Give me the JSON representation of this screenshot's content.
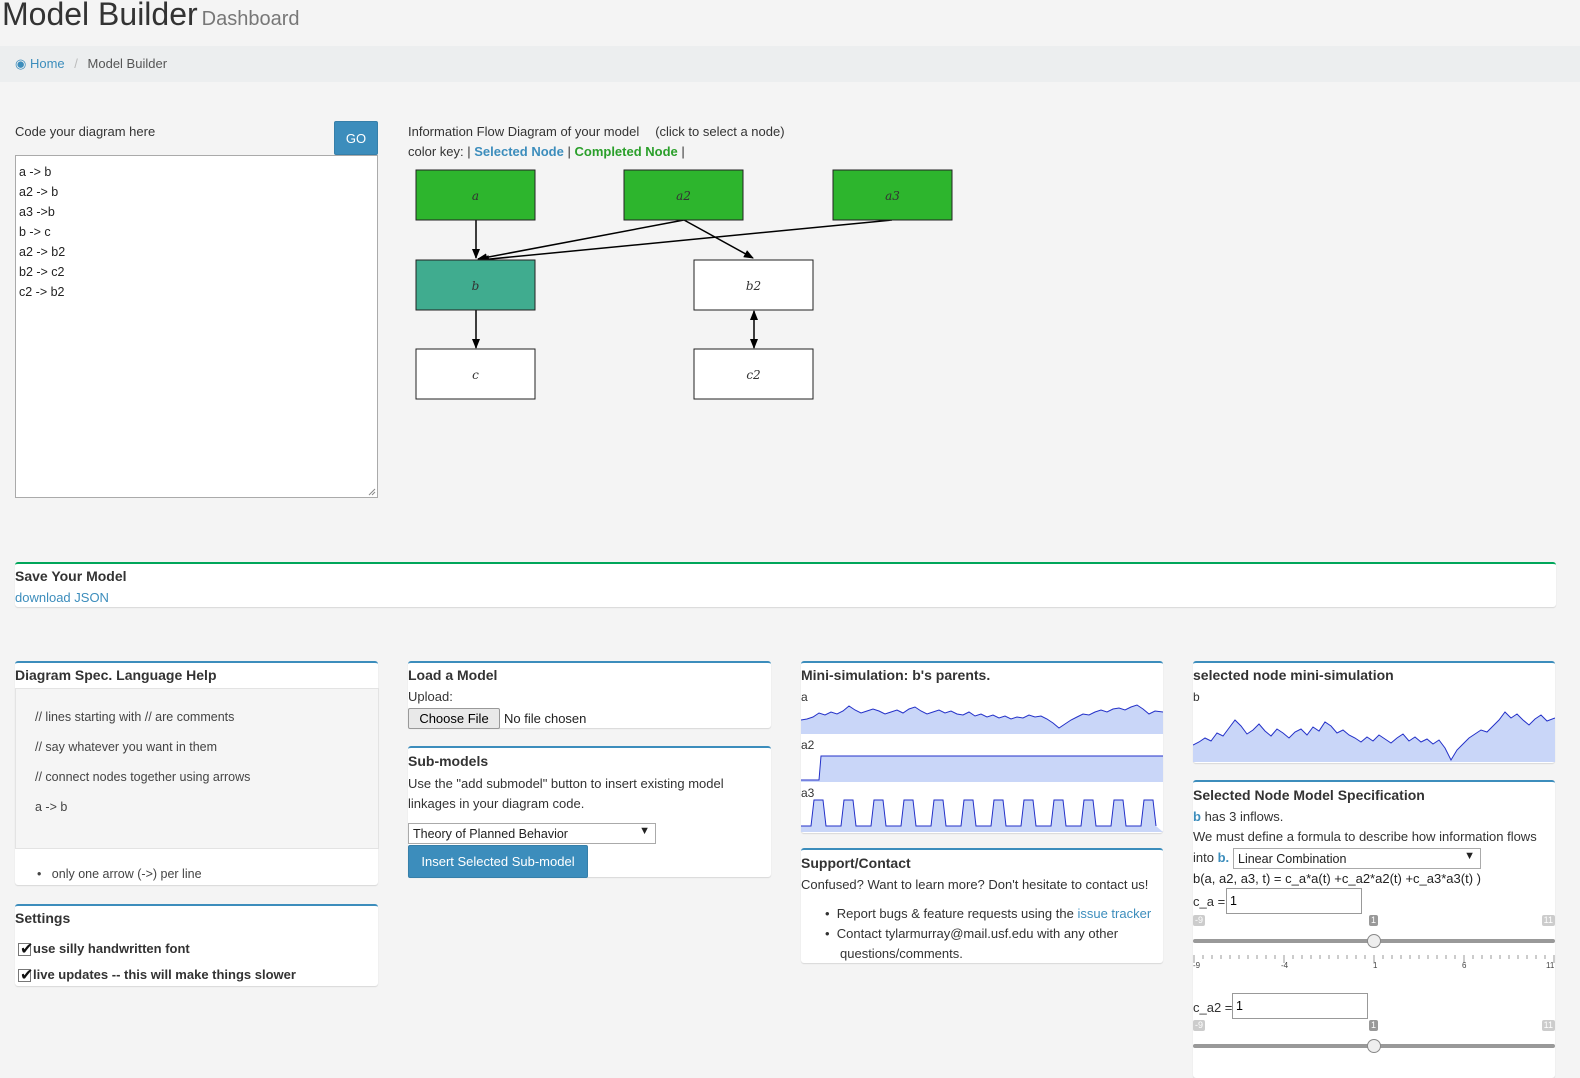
{
  "header": {
    "title": "Model Builder",
    "subtitle": "Dashboard"
  },
  "breadcrumb": {
    "home": "Home",
    "current": "Model Builder"
  },
  "editor": {
    "label": "Code your diagram here",
    "go_label": "GO",
    "lines": [
      "a -> b",
      "a2 -> b",
      "a3 ->b",
      "b -> c",
      "a2 -> b2",
      "b2 -> c2",
      "c2 -> b2"
    ]
  },
  "diagram": {
    "title": "Information Flow Diagram of your model",
    "hint": "(click to select a node)",
    "key_prefix": "color key: |",
    "key_selected": "Selected Node",
    "key_completed": "Completed Node",
    "key_sep": "|",
    "colors": {
      "completed": "#2db52d",
      "selected": "#40ac8f",
      "default": "#ffffff"
    },
    "nodes": [
      {
        "id": "a",
        "state": "completed"
      },
      {
        "id": "a2",
        "state": "completed"
      },
      {
        "id": "a3",
        "state": "completed"
      },
      {
        "id": "b",
        "state": "selected"
      },
      {
        "id": "b2",
        "state": "default"
      },
      {
        "id": "c",
        "state": "default"
      },
      {
        "id": "c2",
        "state": "default"
      }
    ]
  },
  "save": {
    "title": "Save Your Model",
    "link": "download JSON"
  },
  "help": {
    "title": "Diagram Spec. Language Help",
    "lines": [
      "// lines starting with // are comments",
      "// say whatever you want in them",
      "// connect nodes together using arrows",
      "a -> b"
    ],
    "bullet": "only one arrow (->) per line"
  },
  "settings": {
    "title": "Settings",
    "opt1": "use silly handwritten font",
    "opt2": "live updates -- this will make things slower"
  },
  "load": {
    "title": "Load a Model",
    "upload_label": "Upload:",
    "choose": "Choose File",
    "no_file": "No file chosen"
  },
  "submodels": {
    "title": "Sub-models",
    "desc1": "Use the \"add submodel\" button to insert existing model",
    "desc2": "linkages in your diagram code.",
    "selected": "Theory of Planned Behavior",
    "insert": "Insert Selected Sub-model"
  },
  "minisim": {
    "title": "Mini-simulation: b's parents.",
    "labels": [
      "a",
      "a2",
      "a3"
    ]
  },
  "support": {
    "title": "Support/Contact",
    "intro": "Confused? Want to learn more? Don't hesitate to contact us!",
    "b1": "Report bugs & feature requests using the",
    "b1_link": "issue tracker",
    "b2a": "Contact tylarmurray@mail.usf.edu with any other",
    "b2b": "questions/comments."
  },
  "selsim": {
    "title": "selected node mini-simulation",
    "label": "b"
  },
  "spec": {
    "title": "Selected Node Model Specification",
    "inflow_node": "b",
    "inflow_text": "has 3 inflows.",
    "desc": "We must define a formula to describe how information flows",
    "into": "into",
    "into_node": "b.",
    "formula_type": "Linear Combination",
    "formula": "b(a, a2, a3, t) = c_a*a(t) +c_a2*a2(t) +c_a3*a3(t) )",
    "param1": {
      "label": "c_a =",
      "value": "1"
    },
    "param2": {
      "label": "c_a2 =",
      "value": "1"
    },
    "slider": {
      "min": "-9",
      "max": "11",
      "value": "1",
      "ticks": [
        "-9",
        "-4",
        "1",
        "6",
        "11"
      ]
    }
  }
}
